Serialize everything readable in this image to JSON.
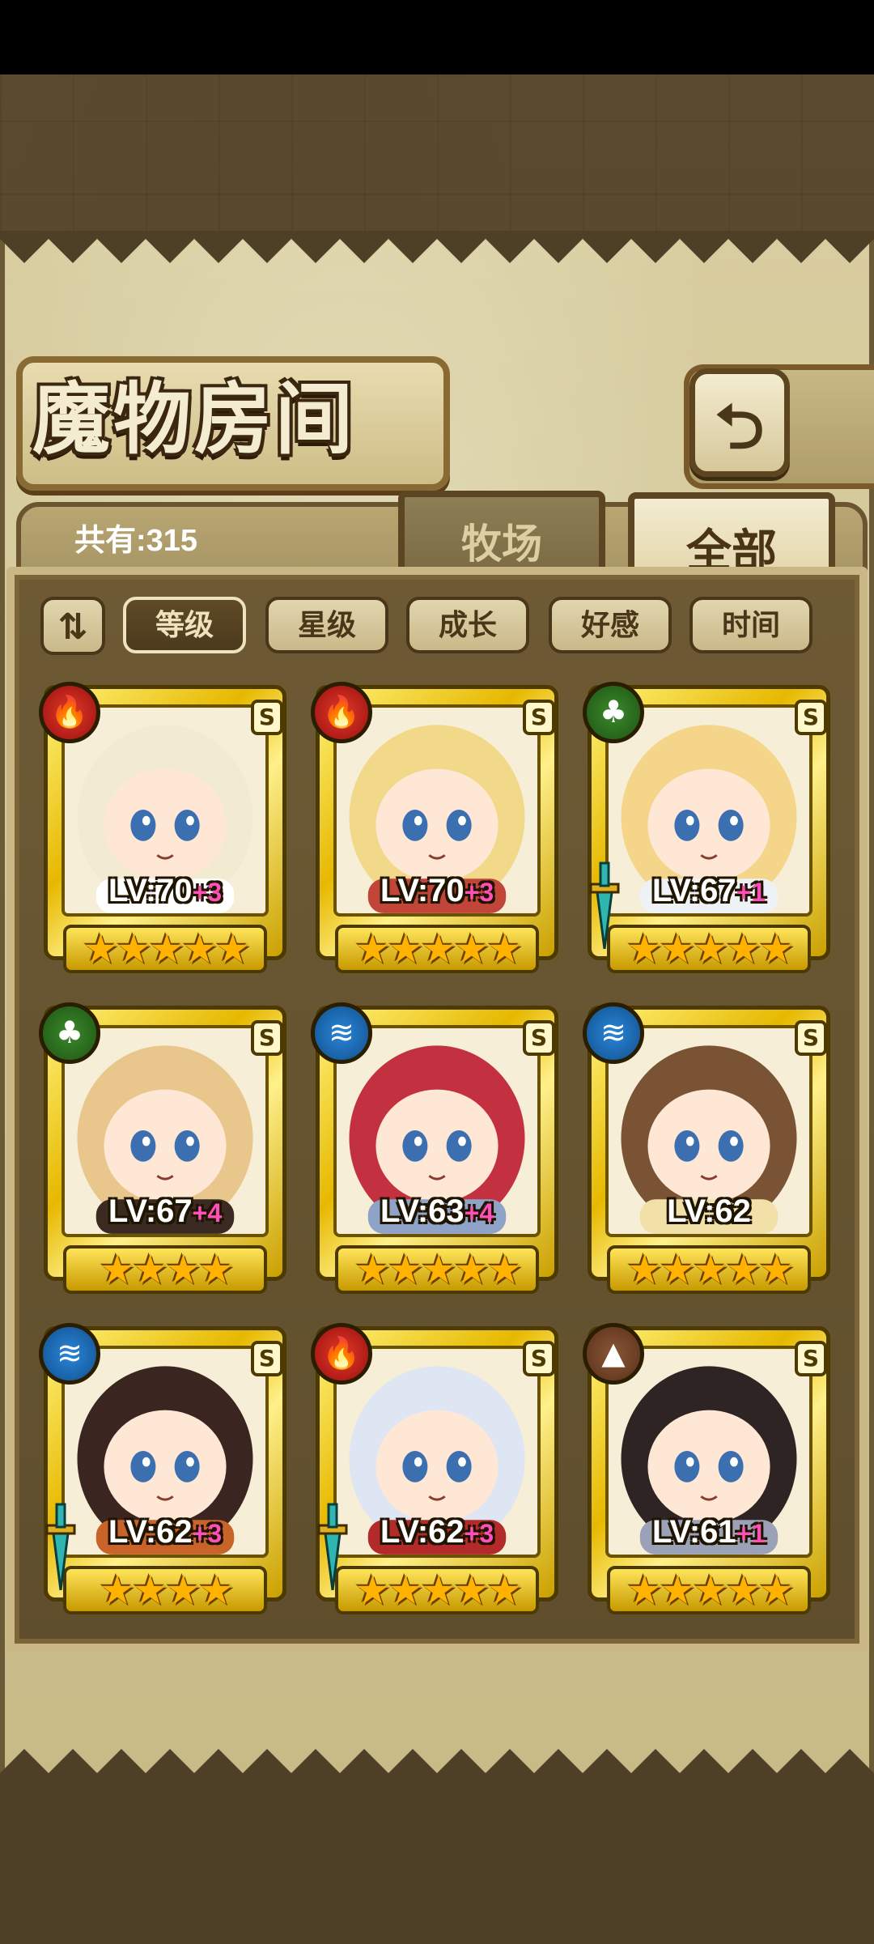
{
  "title": "魔物房间",
  "back_icon": "back-arrow-icon",
  "count_label": "共有:315",
  "tabs": {
    "pasture": "牧场",
    "all": "全部"
  },
  "sort": {
    "order_icon": "sort-order-icon",
    "buttons": [
      "等级",
      "星级",
      "成长",
      "好感",
      "时间"
    ],
    "active": "等级"
  },
  "monsters": [
    {
      "element": "fire",
      "grade": "S",
      "level": "LV:70",
      "plus": "+3",
      "stars": "★★★★★",
      "weapon": false,
      "hair": "#f3ead2",
      "accent": "#ffffff"
    },
    {
      "element": "fire",
      "grade": "S",
      "level": "LV:70",
      "plus": "+3",
      "stars": "★★★★★",
      "weapon": false,
      "hair": "#f2d98a",
      "accent": "#c2453a"
    },
    {
      "element": "leaf",
      "grade": "S",
      "level": "LV:67",
      "plus": "+1",
      "stars": "★★★★★",
      "weapon": true,
      "hair": "#f5d58a",
      "accent": "#eef2f6"
    },
    {
      "element": "leaf",
      "grade": "S",
      "level": "LV:67",
      "plus": "+4",
      "stars": "★★★★",
      "weapon": false,
      "hair": "#e8c68c",
      "accent": "#3a2a22"
    },
    {
      "element": "water",
      "grade": "S",
      "level": "LV:63",
      "plus": "+4",
      "stars": "★★★★★",
      "weapon": false,
      "hair": "#c3303f",
      "accent": "#8fa3c8"
    },
    {
      "element": "water",
      "grade": "S",
      "level": "LV:62",
      "plus": "",
      "stars": "★★★★★",
      "weapon": false,
      "hair": "#7a5234",
      "accent": "#f1e0a8"
    },
    {
      "element": "water",
      "grade": "S",
      "level": "LV:62",
      "plus": "+3",
      "stars": "★★★★",
      "weapon": true,
      "hair": "#3a2520",
      "accent": "#c8632a"
    },
    {
      "element": "fire",
      "grade": "S",
      "level": "LV:62",
      "plus": "+3",
      "stars": "★★★★★",
      "weapon": true,
      "hair": "#dfe6f3",
      "accent": "#b32a2a"
    },
    {
      "element": "earth",
      "grade": "S",
      "level": "LV:61",
      "plus": "+1",
      "stars": "★★★★★",
      "weapon": false,
      "hair": "#2e2424",
      "accent": "#9ba2b8"
    }
  ],
  "element_icons": {
    "fire": "🔥",
    "leaf": "♣",
    "water": "≋",
    "earth": "▲"
  }
}
